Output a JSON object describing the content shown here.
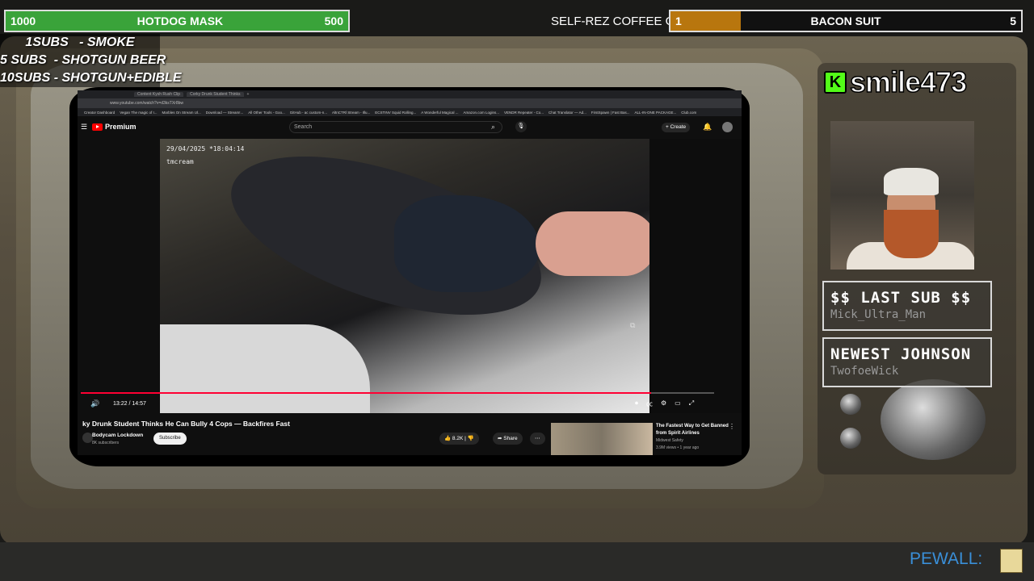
{
  "goals": {
    "left": {
      "start": "1000",
      "title": "HOTDOG MASK",
      "end": "500",
      "progress": 1.0
    },
    "right": {
      "start": "1",
      "title": "BACON SUIT",
      "end": "5",
      "progress": 0.2
    }
  },
  "ticker": "SELF-REZ COFFEE GIVEAWAY",
  "subs_rules": [
    "1SUBS   - SMOKE",
    "5 SUBS  - SHOTGUN BEER",
    "10SUBS - SHOTGUN+EDIBLE"
  ],
  "browser": {
    "tabs": [
      "Content Kysh Rush Clip",
      "Corky Drunk Student Thinks",
      "+"
    ],
    "url": "www.youtube.com/watch?v=d3ksTXr8bw",
    "bookmarks": [
      "Creator Dashboard",
      "Vegan The magic of I...",
      "Marbles On Stream Ul...",
      "Download — Stream!...",
      "All Other Tools - Goo...",
      "GitHub - ac custom-n...",
      "AltnCTRl Stream - Illu...",
      "ECSTINV Squid Rolling...",
      "A Wonderful Magical ...",
      "Amazon.com Logins...",
      "VENDR Repeater - Co...",
      "Chat Translator — Ad...",
      "FirstSpawn | Fast Bas...",
      "ALL-IN-ONE PACKAGE...",
      "Club.com"
    ]
  },
  "youtube": {
    "logo": "Premium",
    "search_placeholder": "Search",
    "create": "Create",
    "video": {
      "timestamp": "29/04/2025 *18:04:14",
      "username": "tmcream",
      "time": "13:22 / 14:57",
      "progress": 0.9
    },
    "title": "ky Drunk Student Thinks He Can Bully 4 Cops — Backfires Fast",
    "channel": "Bodycam Lockdown",
    "subscribers": "8K subscribers",
    "subscribe": "Subscribe",
    "likes": "8.2K",
    "share": "Share",
    "recommended": {
      "title": "The Fastest Way to Get Banned from Spirit Airlines",
      "channel": "Midwest Safety",
      "views": "3.9M views • 1 year ago"
    }
  },
  "streamer": {
    "platform": "K",
    "name": "smile473"
  },
  "last_sub": {
    "title": "$$ LAST SUB $$",
    "name": "Mick_Ultra_Man"
  },
  "newest": {
    "title": "NEWEST JOHNSON",
    "name": "TwofoeWick"
  },
  "paywall": "PEWALL:"
}
